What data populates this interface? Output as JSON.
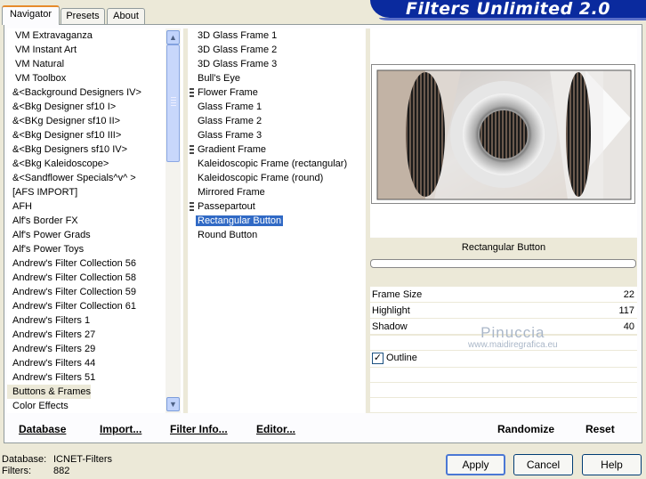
{
  "tabs": [
    {
      "label": "Navigator",
      "active": true
    },
    {
      "label": "Presets",
      "active": false
    },
    {
      "label": "About",
      "active": false
    }
  ],
  "title": "Filters Unlimited 2.0",
  "categories": [
    {
      "label": "VM Extravaganza"
    },
    {
      "label": "VM Instant Art"
    },
    {
      "label": "VM Natural"
    },
    {
      "label": "VM Toolbox"
    },
    {
      "label": "&<Background Designers IV>"
    },
    {
      "label": "&<Bkg Designer sf10 I>"
    },
    {
      "label": "&<BKg Designer sf10 II>"
    },
    {
      "label": "&<Bkg Designer sf10 III>"
    },
    {
      "label": "&<Bkg Designers sf10 IV>"
    },
    {
      "label": "&<Bkg Kaleidoscope>"
    },
    {
      "label": "&<Sandflower Specials^v^ >"
    },
    {
      "label": "[AFS IMPORT]"
    },
    {
      "label": "AFH"
    },
    {
      "label": "Alf's Border FX"
    },
    {
      "label": "Alf's Power Grads"
    },
    {
      "label": "Alf's Power Toys"
    },
    {
      "label": "Andrew's Filter Collection 56"
    },
    {
      "label": "Andrew's Filter Collection 58"
    },
    {
      "label": "Andrew's Filter Collection 59"
    },
    {
      "label": "Andrew's Filter Collection 61"
    },
    {
      "label": "Andrew's Filters 1"
    },
    {
      "label": "Andrew's Filters 27"
    },
    {
      "label": "Andrew's Filters 29"
    },
    {
      "label": "Andrew's Filters 44"
    },
    {
      "label": "Andrew's Filters 51"
    },
    {
      "label": "Buttons & Frames",
      "selected": true
    },
    {
      "label": "Color Effects"
    }
  ],
  "filters": [
    {
      "label": "3D Glass Frame 1"
    },
    {
      "label": "3D Glass Frame 2"
    },
    {
      "label": "3D Glass Frame 3"
    },
    {
      "label": "Bull's Eye"
    },
    {
      "label": "Flower Frame",
      "marker": true
    },
    {
      "label": "Glass Frame 1"
    },
    {
      "label": "Glass Frame 2"
    },
    {
      "label": "Glass Frame 3"
    },
    {
      "label": "Gradient Frame",
      "marker": true
    },
    {
      "label": "Kaleidoscopic Frame (rectangular)"
    },
    {
      "label": "Kaleidoscopic Frame (round)"
    },
    {
      "label": "Mirrored Frame"
    },
    {
      "label": "Passepartout",
      "marker": true
    },
    {
      "label": "Rectangular Button",
      "selected": true
    },
    {
      "label": "Round Button"
    }
  ],
  "preview": {
    "filter_name": "Rectangular Button"
  },
  "params": [
    {
      "label": "Frame Size",
      "value": "22"
    },
    {
      "label": "Highlight",
      "value": "117"
    },
    {
      "label": "Shadow",
      "value": "40"
    }
  ],
  "outline": {
    "label": "Outline",
    "checked": true,
    "mark": "✓"
  },
  "watermark": {
    "name": "Pinuccia",
    "site": "www.maidiregrafica.eu"
  },
  "toolbar": {
    "database": "Database",
    "import": "Import...",
    "filter_info": "Filter Info...",
    "editor": "Editor...",
    "randomize": "Randomize",
    "reset": "Reset"
  },
  "status": {
    "database_label": "Database:",
    "database_value": "ICNET-Filters",
    "filters_label": "Filters:",
    "filters_value": "882"
  },
  "buttons": {
    "apply": "Apply",
    "cancel": "Cancel",
    "help": "Help"
  },
  "scroll": {
    "up": "▲",
    "down": "▼"
  }
}
